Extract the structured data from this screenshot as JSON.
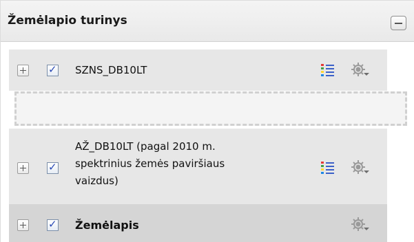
{
  "panel": {
    "title": "Žemėlapio turinys",
    "collapse_icon": "minus-icon"
  },
  "layers": [
    {
      "label": "SZNS_DB10LT",
      "checked": true,
      "has_legend": true,
      "icons": [
        "plus-icon",
        "checkbox-icon",
        "legend-list-icon",
        "gear-icon"
      ]
    },
    {
      "label_lines": [
        "AŽ_DB10LT (pagal 2010 m.",
        "spektrinius žemės paviršiaus",
        "vaizdus)"
      ],
      "checked": true,
      "has_legend": true,
      "icons": [
        "plus-icon",
        "checkbox-icon",
        "legend-list-icon",
        "gear-icon"
      ]
    },
    {
      "label": "Žemėlapis",
      "checked": true,
      "has_legend": false,
      "icons": [
        "plus-icon",
        "checkbox-icon",
        "gear-icon"
      ]
    }
  ],
  "colors": {
    "row_bg": "#e7e7e7",
    "row_bg_active": "#d5d5d5",
    "header_bg": "#eeeeee",
    "checkmark": "#2a49b4"
  }
}
